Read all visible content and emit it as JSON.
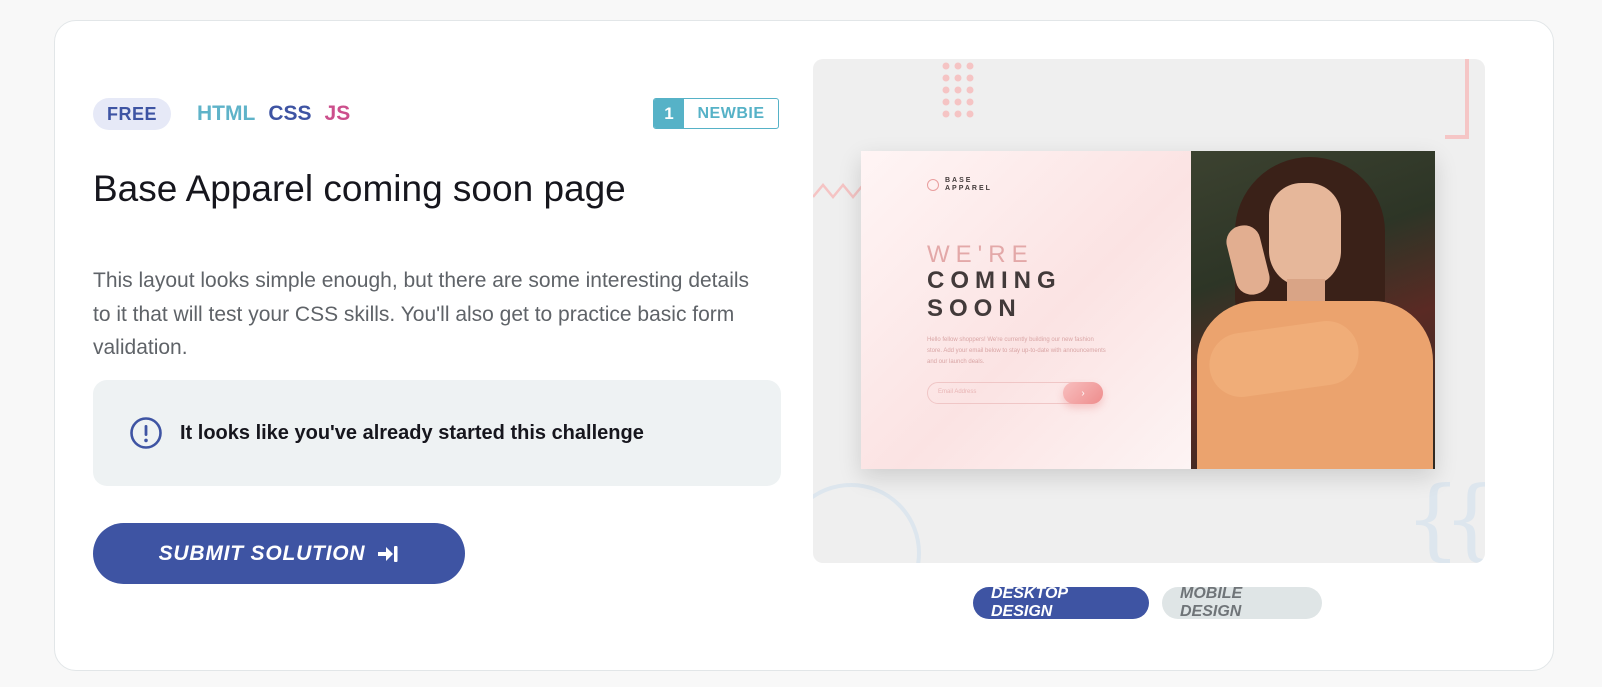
{
  "badges": {
    "free": "FREE",
    "languages": [
      "HTML",
      "CSS",
      "JS"
    ],
    "level_number": "1",
    "level_label": "NEWBIE"
  },
  "challenge": {
    "title": "Base Apparel coming soon page",
    "description": "This layout looks simple enough, but there are some interesting details to it that will test your CSS skills. You'll also get to practice basic form validation."
  },
  "notice": {
    "icon": "info-circle-icon",
    "text": "It looks like you've already started this challenge"
  },
  "submit": {
    "label": "SUBMIT SOLUTION",
    "icon": "arrow-into-bar-icon"
  },
  "preview": {
    "logo_text": "BASE APPAREL",
    "heading_light": "WE'RE",
    "heading_bold": "COMING SOON",
    "copy": "Hello fellow shoppers! We're currently building our new fashion store. Add your email below to stay up-to-date with announcements and our launch deals.",
    "email_placeholder": "Email Address",
    "submit_glyph": "›"
  },
  "views": {
    "desktop_label": "DESKTOP DESIGN",
    "mobile_label": "MOBILE DESIGN",
    "selected": "desktop"
  },
  "colors": {
    "primary": "#3e54a3",
    "teal": "#56b2c7",
    "html": "#5fb3c9",
    "js": "#cc4f8c",
    "notice_bg": "#eef2f3"
  }
}
